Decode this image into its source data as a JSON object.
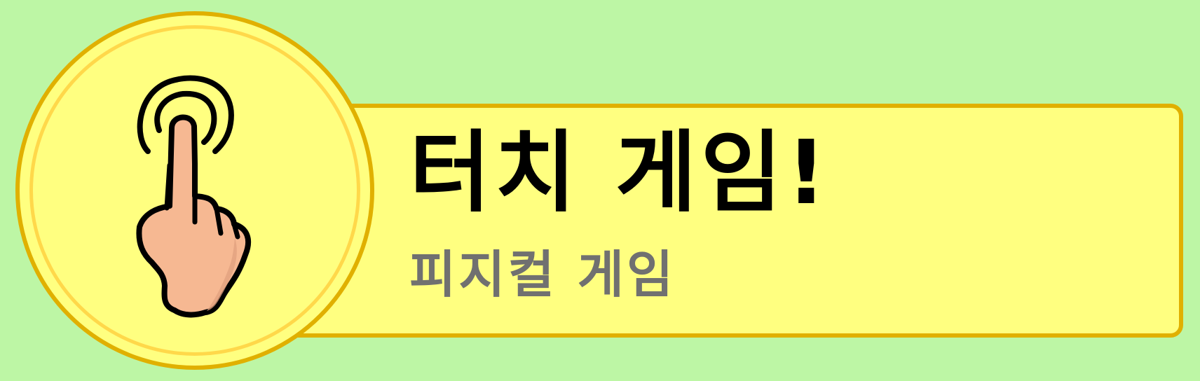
{
  "banner": {
    "title": "터치 게임!",
    "subtitle": "피지컬 게임",
    "icon": "touch-gesture-hand-icon"
  },
  "colors": {
    "background": "#bdf6a5",
    "panel_fill": "#ffff80",
    "panel_border": "#e0b000",
    "title": "#000000",
    "subtitle": "#707070",
    "hand_skin": "#f6b892"
  }
}
